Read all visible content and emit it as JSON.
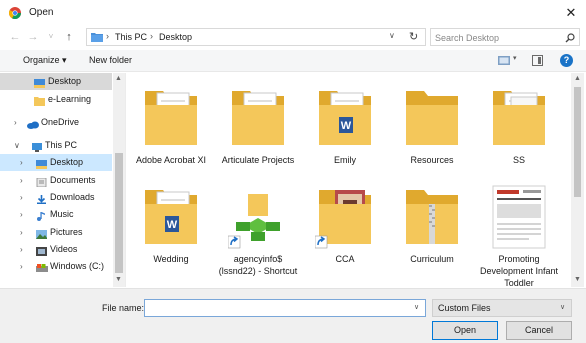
{
  "window": {
    "title": "Open",
    "close_glyph": "✕",
    "app_icon": "chrome-icon"
  },
  "address": {
    "back_glyph": "←",
    "forward_glyph": "→",
    "recent_glyph": "˅",
    "up_glyph": "↑",
    "breadcrumb_sep": "›",
    "crumbs": [
      "This PC",
      "Desktop"
    ],
    "dropdown_glyph": "∨",
    "refresh_glyph": "↻",
    "search_placeholder": "Search Desktop",
    "search_glyph": "⚲"
  },
  "toolbar": {
    "organize_label": "Organize ▾",
    "new_folder_label": "New folder",
    "view_dd_glyph": "▾",
    "help_glyph": "?"
  },
  "nav": {
    "items": [
      {
        "label": "Desktop",
        "icon": "desktop-folder-icon",
        "chev": "",
        "state": "selected"
      },
      {
        "label": "e-Learning",
        "icon": "folder-icon",
        "chev": "",
        "state": ""
      },
      {
        "label": "OneDrive",
        "icon": "cloud-icon",
        "chev": "›",
        "state": ""
      },
      {
        "label": "This PC",
        "icon": "computer-icon",
        "chev": "∨",
        "state": ""
      },
      {
        "label": "Desktop",
        "icon": "desktop-folder-icon",
        "chev": "›",
        "state": "highlighted"
      },
      {
        "label": "Documents",
        "icon": "documents-icon",
        "chev": "›",
        "state": ""
      },
      {
        "label": "Downloads",
        "icon": "downloads-icon",
        "chev": "›",
        "state": ""
      },
      {
        "label": "Music",
        "icon": "music-icon",
        "chev": "›",
        "state": ""
      },
      {
        "label": "Pictures",
        "icon": "pictures-icon",
        "chev": "›",
        "state": ""
      },
      {
        "label": "Videos",
        "icon": "videos-icon",
        "chev": "›",
        "state": ""
      },
      {
        "label": "Windows (C:)",
        "icon": "drive-icon",
        "chev": "›",
        "state": ""
      }
    ],
    "scroll_up": "▲",
    "scroll_down": "▼"
  },
  "files": [
    {
      "name": "Adobe Acrobat XI",
      "kind": "folder-ie"
    },
    {
      "name": "Articulate Projects",
      "kind": "folder-envelope"
    },
    {
      "name": "Emily",
      "kind": "folder-word"
    },
    {
      "name": "Resources",
      "kind": "folder"
    },
    {
      "name": "SS",
      "kind": "folder-docs"
    },
    {
      "name": "Wedding",
      "kind": "folder-word"
    },
    {
      "name": "agencyinfo$ (lssnd22) - Shortcut",
      "kind": "network-shortcut"
    },
    {
      "name": "CCA",
      "kind": "folder-photo-shortcut"
    },
    {
      "name": "Curriculum",
      "kind": "folder-zip"
    },
    {
      "name": "Promoting Development Infant Toddler",
      "kind": "document-thumb"
    }
  ],
  "content_scroll": {
    "up": "▲",
    "down": "▼"
  },
  "footer": {
    "file_name_label": "File name:",
    "file_name_value": "",
    "dropdown_glyph": "∨",
    "file_type": "Custom Files",
    "open_label": "Open",
    "cancel_label": "Cancel"
  },
  "colors": {
    "folder": "#f4c75a",
    "folder_dark": "#e0a92e",
    "selection": "#cce8ff",
    "accent": "#0078d7"
  }
}
